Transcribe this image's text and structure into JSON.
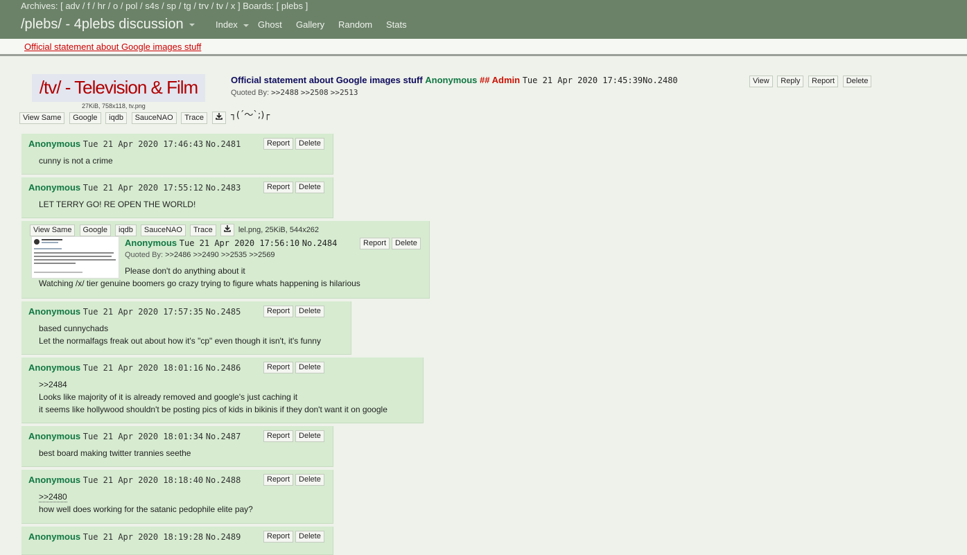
{
  "topbar": {
    "archives_label": "Archives: [",
    "archives": [
      "adv",
      "f",
      "hr",
      "o",
      "pol",
      "s4s",
      "sp",
      "tg",
      "trv",
      "tv",
      "x"
    ],
    "boards_label": "] Boards: [",
    "boards": [
      "plebs"
    ],
    "boards_close": "]",
    "site_title": "/plebs/ - 4plebs discussion",
    "nav": [
      "Index",
      "Ghost",
      "Gallery",
      "Random",
      "Stats"
    ]
  },
  "announcement": "Official statement about Google images stuff",
  "op": {
    "banner_text": "/tv/ - Television & Film",
    "file_info": "27KiB, 758x118, tv.png",
    "image_buttons": [
      "View Same",
      "Google",
      "iqdb",
      "SauceNAO",
      "Trace"
    ],
    "subject": "Official statement about Google images stuff",
    "name": "Anonymous",
    "capcode": "## Admin",
    "date": "Tue 21 Apr 2020 17:45:39",
    "number": "No.2480",
    "buttons": [
      "View",
      "Reply",
      "Report",
      "Delete"
    ],
    "quoted_by_label": "Quoted By:",
    "quoted_by": [
      ">>2488",
      ">>2508",
      ">>2513"
    ],
    "body": "┐(´～`;)┌"
  },
  "reply_buttons": [
    "Report",
    "Delete"
  ],
  "replies": [
    {
      "name": "Anonymous",
      "date": "Tue 21 Apr 2020 17:46:43",
      "number": "No.2481",
      "lines": [
        "cunny is not a crime"
      ]
    },
    {
      "name": "Anonymous",
      "date": "Tue 21 Apr 2020 17:55:12",
      "number": "No.2483",
      "lines": [
        "LET TERRY GO! RE OPEN THE WORLD!"
      ]
    },
    {
      "name": "Anonymous",
      "date": "Tue 21 Apr 2020 17:56:10",
      "number": "No.2484",
      "image_buttons": [
        "View Same",
        "Google",
        "iqdb",
        "SauceNAO",
        "Trace"
      ],
      "file_info": "lel.png, 25KiB, 544x262",
      "quoted_by_label": "Quoted By:",
      "quoted_by": ">>2486 >>2490 >>2535 >>2569",
      "lines": [
        "Please don't do anything about it",
        "Watching /x/ tier genuine boomers go crazy trying to figure whats happening is hilarious"
      ]
    },
    {
      "name": "Anonymous",
      "date": "Tue 21 Apr 2020 17:57:35",
      "number": "No.2485",
      "lines": [
        "based cunnychads",
        "Let the normalfags freak out about how it's \"cp\" even though it isn't, it's funny"
      ]
    },
    {
      "name": "Anonymous",
      "date": "Tue 21 Apr 2020 18:01:16",
      "number": "No.2486",
      "lines": [
        ">>2484",
        "Looks like majority of it is already removed and google's just caching it",
        "it seems like hollywood shouldn't be posting pics of kids in bikinis if they don't want it on google"
      ]
    },
    {
      "name": "Anonymous",
      "date": "Tue 21 Apr 2020 18:01:34",
      "number": "No.2487",
      "lines": [
        "best board making twitter trannies seethe"
      ]
    },
    {
      "name": "Anonymous",
      "date": "Tue 21 Apr 2020 18:18:40",
      "number": "No.2488",
      "lines": [
        ">>2480",
        "how well does working for the satanic pedophile elite pay?"
      ]
    },
    {
      "name": "Anonymous",
      "date": "Tue 21 Apr 2020 18:19:28",
      "number": "No.2489",
      "lines": []
    }
  ]
}
